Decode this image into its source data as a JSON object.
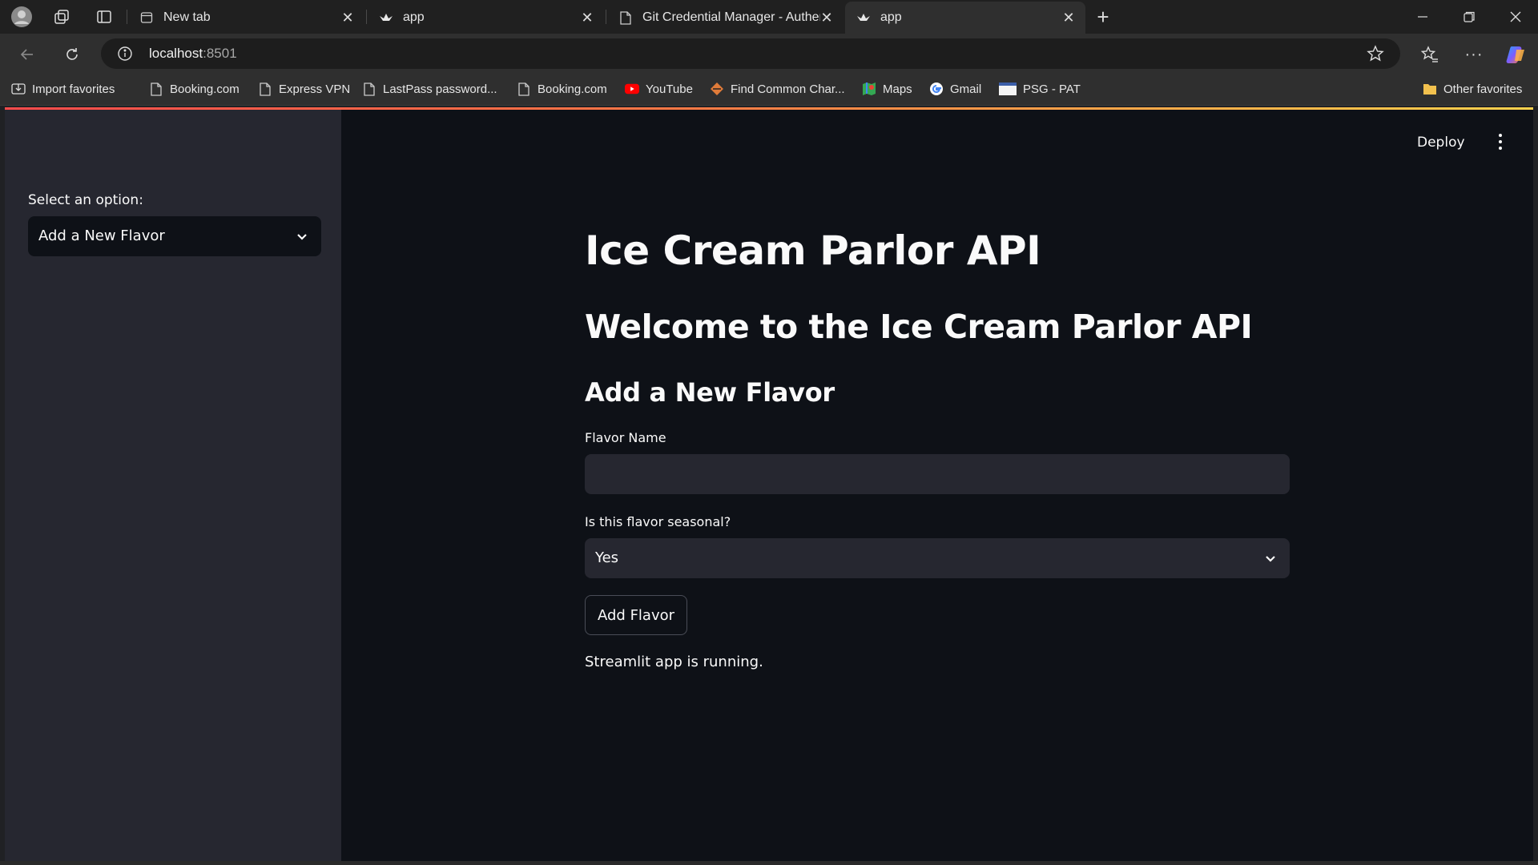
{
  "browser": {
    "tabs": [
      {
        "title": "New tab",
        "favicon": "newtab-icon",
        "active": false
      },
      {
        "title": "app",
        "favicon": "streamlit-crown-icon",
        "active": false
      },
      {
        "title": "Git Credential Manager - Authent",
        "favicon": "document-icon",
        "active": false
      },
      {
        "title": "app",
        "favicon": "streamlit-crown-icon",
        "active": true
      }
    ],
    "address": {
      "host": "localhost",
      "port": ":8501"
    },
    "bookmarks": [
      {
        "label": "Import favorites",
        "icon": "import-icon"
      },
      {
        "label": "Booking.com",
        "icon": "document-icon"
      },
      {
        "label": "Express VPN",
        "icon": "document-icon"
      },
      {
        "label": "LastPass password...",
        "icon": "document-icon"
      },
      {
        "label": "Booking.com",
        "icon": "document-icon"
      },
      {
        "label": "YouTube",
        "icon": "youtube-icon"
      },
      {
        "label": "Find Common Char...",
        "icon": "findchar-icon"
      },
      {
        "label": "Maps",
        "icon": "maps-icon"
      },
      {
        "label": "Gmail",
        "icon": "google-icon"
      },
      {
        "label": "PSG - PAT",
        "icon": "psg-icon"
      }
    ],
    "other_favorites": "Other favorites"
  },
  "app": {
    "sidebar": {
      "label": "Select an option:",
      "selected": "Add a New Flavor"
    },
    "header": {
      "deploy": "Deploy"
    },
    "main": {
      "title": "Ice Cream Parlor API",
      "welcome": "Welcome to the Ice Cream Parlor API",
      "section": "Add a New Flavor",
      "flavor_label": "Flavor Name",
      "flavor_value": "",
      "seasonal_label": "Is this flavor seasonal?",
      "seasonal_selected": "Yes",
      "submit": "Add Flavor",
      "status": "Streamlit app is running."
    }
  },
  "colors": {
    "sidebar_bg": "#262730",
    "main_bg": "#0e1117",
    "text": "#fafafa",
    "accent": "#ff4b4b"
  }
}
